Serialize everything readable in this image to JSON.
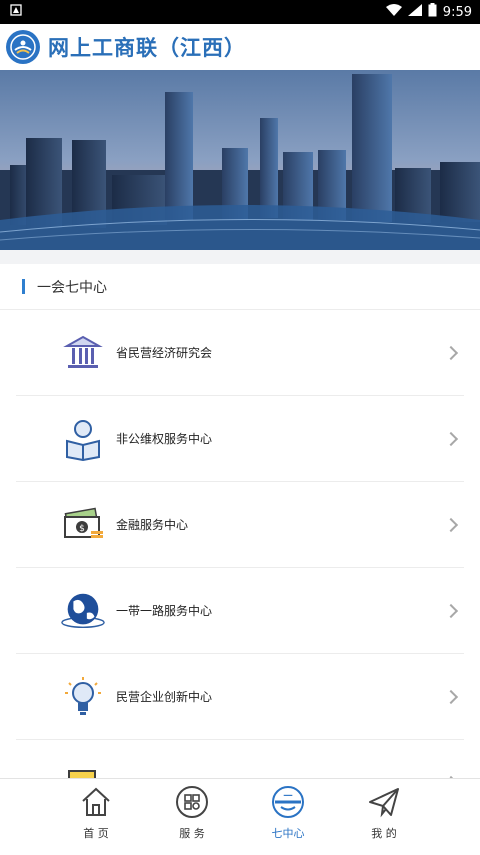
{
  "statusbar": {
    "time": "9:59"
  },
  "header": {
    "title": "网上工商联（江西）"
  },
  "section": {
    "title": "一会七中心",
    "items": [
      {
        "label": "省民营经济研究会",
        "icon": "institution-icon"
      },
      {
        "label": "非公维权服务中心",
        "icon": "person-reading-icon"
      },
      {
        "label": "金融服务中心",
        "icon": "money-icon"
      },
      {
        "label": "一带一路服务中心",
        "icon": "globe-icon"
      },
      {
        "label": "民营企业创新中心",
        "icon": "lightbulb-icon"
      },
      {
        "label": "",
        "icon": "document-icon"
      }
    ]
  },
  "tabs": [
    {
      "label": "首 页",
      "icon": "home-icon"
    },
    {
      "label": "服 务",
      "icon": "services-grid-icon"
    },
    {
      "label": "七中心",
      "icon": "center-badge-icon",
      "active": true
    },
    {
      "label": "我 的",
      "icon": "paper-plane-icon"
    }
  ],
  "colors": {
    "accent": "#2a73c4",
    "title": "#2a6fb8"
  }
}
